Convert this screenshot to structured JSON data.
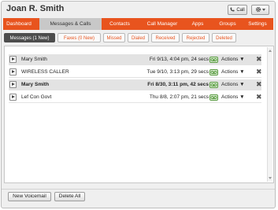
{
  "header": {
    "title": "Joan R. Smith",
    "call_label": "Call"
  },
  "icons": {
    "call": "phone-icon",
    "settings": "gear-icon",
    "play": "play-icon",
    "voicemail": "voicemail-icon",
    "delete": "delete-icon"
  },
  "colors": {
    "accent": "#e8541e",
    "nav_active_bg": "#c8c8c8",
    "subtab_active_bg": "#4d4d4d"
  },
  "nav": {
    "items": [
      {
        "label": "Dashboard"
      },
      {
        "label": "Messages & Calls"
      },
      {
        "label": "Contacts"
      },
      {
        "label": "Call Manager"
      },
      {
        "label": "Apps"
      },
      {
        "label": "Groups"
      },
      {
        "label": "Settings"
      }
    ],
    "active": "Messages & Calls"
  },
  "subtabs": {
    "items": [
      {
        "label": "Messages (1 New)"
      },
      {
        "label": "Faxes (0 New)"
      },
      {
        "label": "Missed"
      },
      {
        "label": "Dialed"
      },
      {
        "label": "Received"
      },
      {
        "label": "Rejected"
      },
      {
        "label": "Deleted"
      }
    ],
    "active": "Messages (1 New)"
  },
  "messages": [
    {
      "name": "Mary Smith",
      "datetime": "Fri 9/13, 4:04 pm, 24 secs",
      "actions": "Actions ▼"
    },
    {
      "name": "WIRELESS CALLER",
      "datetime": "Tue 9/10, 3:13 pm, 29 secs",
      "actions": "Actions ▼"
    },
    {
      "name": "Mary Smith",
      "datetime": "Fri 8/30, 3:11 pm, 42 secs",
      "actions": "Actions ▼"
    },
    {
      "name": "Lef Con Govt",
      "datetime": "Thu 8/8, 2:07 pm, 21 secs",
      "actions": "Actions ▼"
    }
  ],
  "footer": {
    "new_voicemail": "New Voicemail",
    "delete_all": "Delete All"
  }
}
